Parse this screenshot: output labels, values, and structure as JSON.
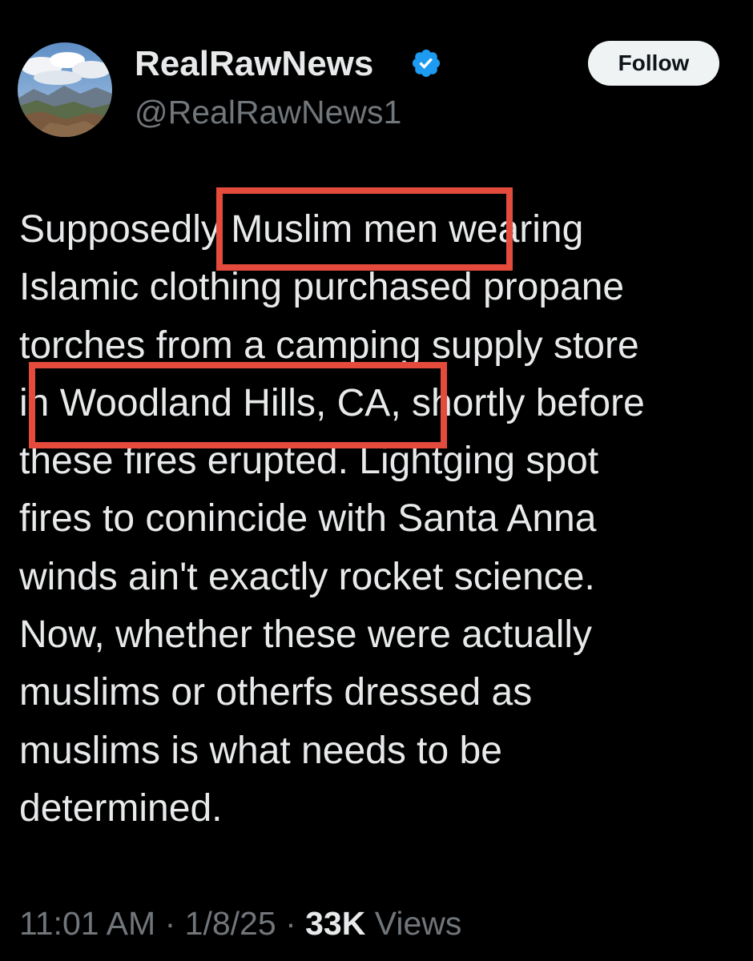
{
  "author": {
    "display_name": "RealRawNews",
    "handle": "@RealRawNews1",
    "verified_icon": "verified-badge-icon",
    "avatar": "mountain-landscape-photo"
  },
  "follow_button": {
    "label": "Follow"
  },
  "tweet": {
    "lines": [
      "Supposedly Muslim men wearing",
      "Islamic clothing purchased propane",
      "torches from a camping supply store",
      "in Woodland Hills, CA, shortly before",
      "these fires erupted. Lightging spot",
      "fires to conincide with Santa Anna",
      "winds ain't exactly rocket science.",
      "Now, whether these were actually",
      "muslims or otherfs dressed as",
      "muslims is what needs to be",
      "determined."
    ],
    "highlights": [
      "Muslim men",
      "Woodland Hills, CA,"
    ]
  },
  "meta": {
    "time": "11:01 AM",
    "separator": "·",
    "date": "1/8/25",
    "views_count": "33K",
    "views_label": "Views"
  },
  "colors": {
    "background": "#000000",
    "text": "#e7e9ea",
    "secondary_text": "#71767b",
    "verified_blue": "#1d9bf0",
    "highlight_red": "#e54b3c",
    "follow_bg": "#eff3f4"
  }
}
